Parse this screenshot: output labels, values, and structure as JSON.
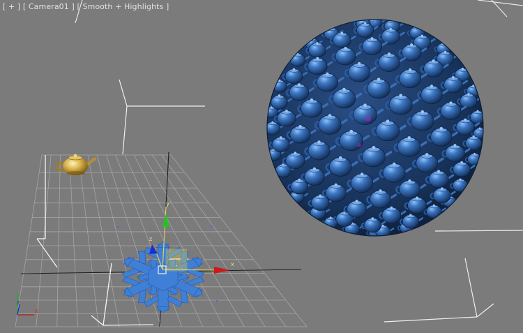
{
  "viewport": {
    "label_menu": "[ + ]",
    "label_camera": "[ Camera01 ]",
    "label_shading": "[ Smooth + Highlights ]"
  },
  "gizmo": {
    "x_label": "x",
    "y_label": "y",
    "z_label": "z"
  },
  "axis_tripod": {
    "x_label": "x",
    "y_label": "y",
    "z_label": "z"
  },
  "colors": {
    "background": "#7b7b7b",
    "grid": "#9a9a9a",
    "teapot": "#c9a43a",
    "sphere": "#2c5d9c",
    "snowflake": "#3f7fd6",
    "gizmo_x": "#d01818",
    "gizmo_y": "#18c018",
    "gizmo_z": "#1830d0"
  }
}
